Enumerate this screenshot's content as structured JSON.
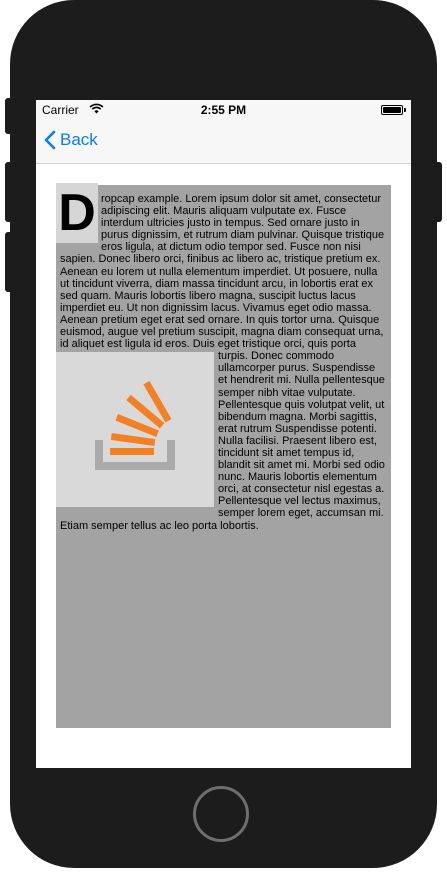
{
  "status_bar": {
    "carrier": "Carrier",
    "time": "2:55 PM",
    "icons": [
      "wifi-icon",
      "battery-icon"
    ]
  },
  "nav": {
    "back_label": "Back",
    "back_icon": "chevron-left-icon",
    "tint": "#0a7aff"
  },
  "content": {
    "dropcap_letter": "D",
    "paragraph_part1": "ropcap example. Lorem ipsum dolor sit amet, consectetur adipiscing elit. Mauris aliquam vulputate ex. Fusce interdum ultricies justo in tempus. Sed ornare justo in purus dignissim, et rutrum diam pulvinar. Quisque tristique eros ligula, at dictum odio tempor sed. Fusce non nisi sapien. Donec libero orci, finibus ac libero ac, tristique pretium ex. Aenean eu lorem ut nulla elementum imperdiet. Ut posuere, nulla ut tincidunt viverra, diam massa tincidunt arcu, in lobortis erat ex sed quam. Mauris lobortis libero magna, suscipit luctus lacus imperdiet eu. Ut non dignissim lacus. Vivamus eget odio massa. Aenean pretium eget erat sed ornare. In quis tortor urna. Quisque euismod, augue vel pretium suscipit, magna diam consequat urna, id aliquet est ligula id eros. Duis eget",
    "paragraph_part2": "tristique orci, quis porta turpis. Donec commodo ullamcorper purus. Suspendisse et hendrerit mi. Nulla pellentesque semper nibh vitae vulputate. Pellentesque quis volutpat velit, ut bibendum magna. Morbi sagittis, erat rutrum Suspendisse potenti. Nulla facilisi. Praesent libero est, tincidunt sit amet tempus id, blandit sit amet mi. Morbi sed odio nunc. Mauris lobortis elementum orci, at consectetur nisl egestas a. Pellentesque vel lectus maximus, semper lorem eget, accumsan mi. Etiam semper tellus ac leo porta lobortis.",
    "image_icon": "stackoverflow-logo-icon",
    "text_background": "#a3a3a3"
  }
}
